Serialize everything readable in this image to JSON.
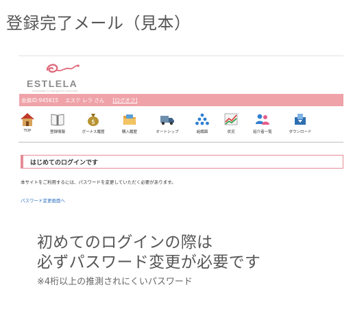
{
  "page_title": "登録完了メール（見本）",
  "logo": {
    "text": "ESTLELA",
    "tagline": "Sustainable & Intelligent Environment",
    "color": "#e06b7c"
  },
  "user_bar": {
    "member_id": "会員ID:945615",
    "user_name": "エステ レラ さん",
    "logout": "[ログオフ]",
    "color": "#efa3a9"
  },
  "nav": {
    "items": [
      {
        "label": "TOP",
        "icon": "home-icon"
      },
      {
        "label": "登録情報",
        "icon": "book-icon"
      },
      {
        "label": "ボーナス履歴",
        "icon": "money-bag-icon"
      },
      {
        "label": "購入履歴",
        "icon": "folder-icon"
      },
      {
        "label": "オートシップ",
        "icon": "truck-icon"
      },
      {
        "label": "組織図",
        "icon": "organization-icon"
      },
      {
        "label": "状況",
        "icon": "chart-icon"
      },
      {
        "label": "紹介者一覧",
        "icon": "users-icon"
      },
      {
        "label": "ダウンロード",
        "icon": "download-icon"
      }
    ]
  },
  "main": {
    "heading": "はじめてのログインです",
    "notice": "本サイトをご利用するには、パスワードを変更していただく必要があります。",
    "link": "パスワード変更画面へ"
  },
  "callout": {
    "line1": "初めてのログインの際は",
    "line2": "必ずパスワード変更が必要です",
    "note": "※4桁以上の推測されにくいパスワード"
  }
}
